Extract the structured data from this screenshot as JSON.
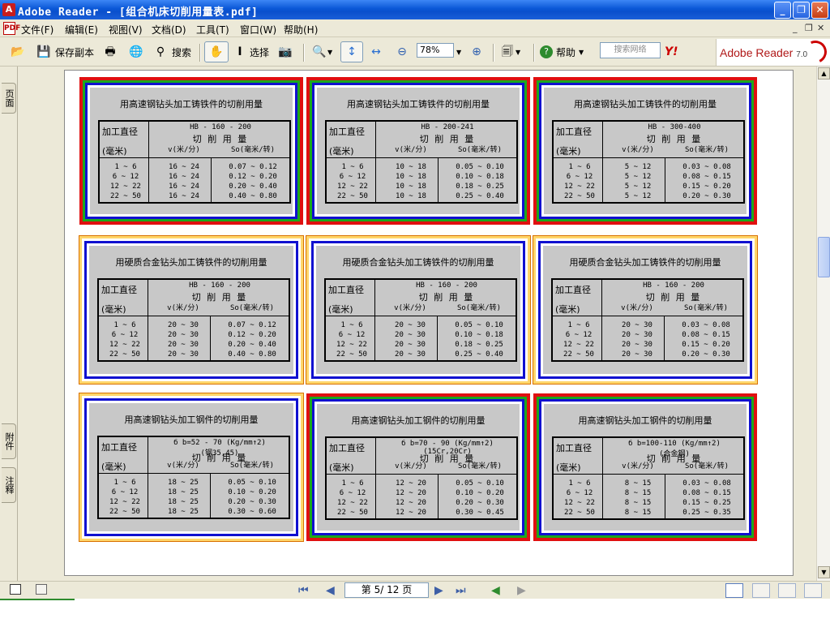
{
  "window": {
    "title": "Adobe Reader - [组合机床切削用量表.pdf]",
    "app_letter": "A"
  },
  "menu": [
    "文件(F)",
    "编辑(E)",
    "视图(V)",
    "文档(D)",
    "工具(T)",
    "窗口(W)",
    "帮助(H)"
  ],
  "toolbar": {
    "save_copy": "保存副本",
    "search": "搜索",
    "select": "选择",
    "zoom": "78%",
    "help": "帮助",
    "web_search_placeholder": "搜索网络",
    "brand": "Adobe Reader",
    "version": "7.0"
  },
  "side_tabs": {
    "pages": "页面",
    "attachments": "附件",
    "comments": "注释"
  },
  "status": {
    "page": "第 5/ 12 页"
  },
  "cards": [
    {
      "title": "用高速钢钻头加工铸铁件的切削用量",
      "cond": "HB - 160 - 200",
      "cond2": "",
      "frame": "red",
      "d": [
        "1 ~ 6",
        "6 ~ 12",
        "12 ~ 22",
        "22 ~ 50"
      ],
      "v": [
        "16 ~ 24",
        "16 ~ 24",
        "16 ~ 24",
        "16 ~ 24"
      ],
      "s": [
        "0.07 ~ 0.12",
        "0.12 ~ 0.20",
        "0.20 ~ 0.40",
        "0.40 ~ 0.80"
      ]
    },
    {
      "title": "用高速钢钻头加工铸铁件的切削用量",
      "cond": "HB - 200-241",
      "cond2": "",
      "frame": "red",
      "d": [
        "1 ~ 6",
        "6 ~ 12",
        "12 ~ 22",
        "22 ~ 50"
      ],
      "v": [
        "10 ~ 18",
        "10 ~ 18",
        "10 ~ 18",
        "10 ~ 18"
      ],
      "s": [
        "0.05 ~ 0.10",
        "0.10 ~ 0.18",
        "0.18 ~ 0.25",
        "0.25 ~ 0.40"
      ]
    },
    {
      "title": "用高速钢钻头加工铸铁件的切削用量",
      "cond": "HB - 300-400",
      "cond2": "",
      "frame": "red",
      "d": [
        "1 ~ 6",
        "6 ~ 12",
        "12 ~ 22",
        "22 ~ 50"
      ],
      "v": [
        "5 ~ 12",
        "5 ~ 12",
        "5 ~ 12",
        "5 ~ 12"
      ],
      "s": [
        "0.03 ~ 0.08",
        "0.08 ~ 0.15",
        "0.15 ~ 0.20",
        "0.20 ~ 0.30"
      ]
    },
    {
      "title": "用硬质合金钻头加工铸铁件的切削用量",
      "cond": "HB - 160 - 200",
      "cond2": "",
      "frame": "plain",
      "d": [
        "1 ~ 6",
        "6 ~ 12",
        "12 ~ 22",
        "22 ~ 50"
      ],
      "v": [
        "20 ~ 30",
        "20 ~ 30",
        "20 ~ 30",
        "20 ~ 30"
      ],
      "s": [
        "0.07 ~ 0.12",
        "0.12 ~ 0.20",
        "0.20 ~ 0.40",
        "0.40 ~ 0.80"
      ]
    },
    {
      "title": "用硬质合金钻头加工铸铁件的切削用量",
      "cond": "HB - 160 - 200",
      "cond2": "",
      "frame": "plain",
      "d": [
        "1 ~ 6",
        "6 ~ 12",
        "12 ~ 22",
        "22 ~ 50"
      ],
      "v": [
        "20 ~ 30",
        "20 ~ 30",
        "20 ~ 30",
        "20 ~ 30"
      ],
      "s": [
        "0.05 ~ 0.10",
        "0.10 ~ 0.18",
        "0.18 ~ 0.25",
        "0.25 ~ 0.40"
      ]
    },
    {
      "title": "用硬质合金钻头加工铸铁件的切削用量",
      "cond": "HB - 160 - 200",
      "cond2": "",
      "frame": "plain",
      "d": [
        "1 ~ 6",
        "6 ~ 12",
        "12 ~ 22",
        "22 ~ 50"
      ],
      "v": [
        "20 ~ 30",
        "20 ~ 30",
        "20 ~ 30",
        "20 ~ 30"
      ],
      "s": [
        "0.03 ~ 0.08",
        "0.08 ~ 0.15",
        "0.15 ~ 0.20",
        "0.20 ~ 0.30"
      ]
    },
    {
      "title": "用高速钢钻头加工钢件的切削用量",
      "cond": "б b=52 - 70  (Kg/mm↑2)",
      "cond2": "(钢35,45)",
      "frame": "plain",
      "d": [
        "1 ~ 6",
        "6 ~ 12",
        "12 ~ 22",
        "22 ~ 50"
      ],
      "v": [
        "18 ~ 25",
        "18 ~ 25",
        "18 ~ 25",
        "18 ~ 25"
      ],
      "s": [
        "0.05 ~ 0.10",
        "0.10 ~ 0.20",
        "0.20 ~ 0.30",
        "0.30 ~ 0.60"
      ]
    },
    {
      "title": "用高速钢钻头加工钢件的切削用量",
      "cond": "б b=70 - 90  (Kg/mm↑2)",
      "cond2": "(15Cr,20Cr)",
      "frame": "red",
      "d": [
        "1 ~ 6",
        "6 ~ 12",
        "12 ~ 22",
        "22 ~ 50"
      ],
      "v": [
        "12 ~ 20",
        "12 ~ 20",
        "12 ~ 20",
        "12 ~ 20"
      ],
      "s": [
        "0.05 ~ 0.10",
        "0.10 ~ 0.20",
        "0.20 ~ 0.30",
        "0.30 ~ 0.45"
      ]
    },
    {
      "title": "用高速钢钻头加工钢件的切削用量",
      "cond": "б b=100-110  (Kg/mm↑2)",
      "cond2": "(合金钢)",
      "frame": "red",
      "d": [
        "1 ~ 6",
        "6 ~ 12",
        "12 ~ 22",
        "22 ~ 50"
      ],
      "v": [
        "8 ~ 15",
        "8 ~ 15",
        "8 ~ 15",
        "8 ~ 15"
      ],
      "s": [
        "0.03 ~ 0.08",
        "0.08 ~ 0.15",
        "0.15 ~ 0.25",
        "0.25 ~ 0.35"
      ]
    }
  ],
  "table_labels": {
    "dia": "加工直径",
    "mm": "(毫米)",
    "cut": "切 削 用 量",
    "v": "v(米/分)",
    "s": "So(毫米/转)"
  }
}
